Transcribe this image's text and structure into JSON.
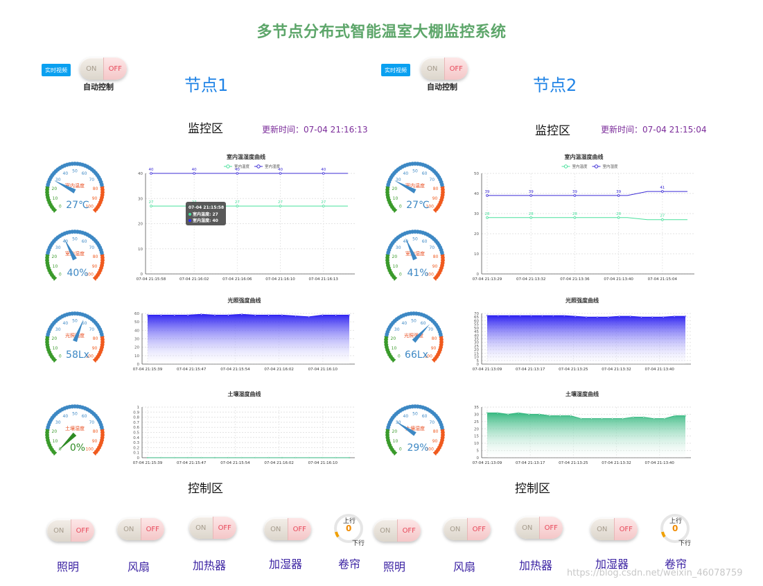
{
  "header": {
    "title": "多节点分布式智能温室大棚监控系统"
  },
  "nodes": [
    {
      "video_label": "实时视频",
      "auto_control_label": "自动控制",
      "auto_toggle": {
        "on": "ON",
        "off": "OFF"
      },
      "name": "节点1",
      "monitor_title": "监控区",
      "update_time": "更新时间：07-04 21:16:13",
      "gauges": [
        {
          "title": "室内温度",
          "value": 27,
          "display": "27℃",
          "color": "#3d88c4"
        },
        {
          "title": "室内湿度",
          "value": 40,
          "display": "40%",
          "color": "#3d88c4"
        },
        {
          "title": "光照强度",
          "value": 58,
          "display": "58Lx",
          "color": "#3d88c4"
        },
        {
          "title": "土壤湿度",
          "value": 0,
          "display": "0%",
          "color": "#2e8b24"
        }
      ],
      "temp_chart": {
        "title": "室内温湿度曲线",
        "legend": [
          "室内温度",
          "室内湿度"
        ],
        "ylim": [
          0,
          40
        ],
        "yticks": [
          "0",
          "10",
          "20",
          "30",
          "40"
        ],
        "xticks": [
          "07-04 21:15:58",
          "07-04 21:16:02",
          "07-04 21:16:06",
          "07-04 21:16:10",
          "07-04 21:16:13"
        ],
        "series": [
          {
            "name": "室内温度",
            "values": [
              27,
              27,
              27,
              27,
              27,
              27
            ],
            "labels": [
              "27",
              "27",
              "27",
              "27",
              "27"
            ]
          },
          {
            "name": "室内湿度",
            "values": [
              40,
              40,
              40,
              40,
              40,
              40
            ],
            "labels": [
              "40",
              "40",
              "40",
              "40",
              "40"
            ]
          }
        ],
        "tooltip": {
          "time": "07-04 21:15:58",
          "line1": "室内温度: 27",
          "line2": "室内湿度: 40"
        }
      },
      "light_chart": {
        "title": "光照强度曲线",
        "ylim": [
          0,
          60
        ],
        "yticks": [
          "0",
          "10",
          "20",
          "30",
          "40",
          "50",
          "60"
        ],
        "xticks": [
          "07-04 21:15:39",
          "07-04 21:15:47",
          "07-04 21:15:54",
          "07-04 21:16:02",
          "07-04 21:16:10"
        ],
        "values": [
          58,
          58,
          58,
          58,
          59,
          58,
          58,
          59,
          58,
          58,
          58,
          57,
          56,
          58,
          58,
          58
        ]
      },
      "soil_chart": {
        "title": "土壤湿度曲线",
        "ylim": [
          0,
          1
        ],
        "yticks": [
          "0",
          "0.1",
          "0.2",
          "0.3",
          "0.4",
          "0.5",
          "0.6",
          "0.7",
          "0.8",
          "0.9",
          "1"
        ],
        "xticks": [
          "07-04 21:15:39",
          "07-04 21:15:47",
          "07-04 21:15:54",
          "07-04 21:16:02",
          "07-04 21:16:10"
        ],
        "values": [
          0,
          0,
          0,
          0,
          0,
          0,
          0,
          0,
          0,
          0,
          0,
          0,
          0,
          0,
          0,
          0
        ]
      },
      "control_title": "控制区",
      "controls": [
        {
          "label": "照明",
          "on": "ON",
          "off": "OFF"
        },
        {
          "label": "风扇",
          "on": "ON",
          "off": "OFF"
        },
        {
          "label": "加热器",
          "on": "ON",
          "off": "OFF"
        },
        {
          "label": "加湿器",
          "on": "ON",
          "off": "OFF"
        }
      ],
      "curtain": {
        "label": "卷帘",
        "up": "上行",
        "down": "下行",
        "value": "0"
      }
    },
    {
      "video_label": "实时视频",
      "auto_control_label": "自动控制",
      "auto_toggle": {
        "on": "ON",
        "off": "OFF"
      },
      "name": "节点2",
      "monitor_title": "监控区",
      "update_time": "更新时间：07-04 21:15:04",
      "gauges": [
        {
          "title": "室内温度",
          "value": 27,
          "display": "27℃",
          "color": "#3d88c4"
        },
        {
          "title": "室内湿度",
          "value": 41,
          "display": "41%",
          "color": "#3d88c4"
        },
        {
          "title": "光照强度",
          "value": 66,
          "display": "66Lx",
          "color": "#3d88c4"
        },
        {
          "title": "土壤湿度",
          "value": 29,
          "display": "29%",
          "color": "#3d88c4"
        }
      ],
      "temp_chart": {
        "title": "室内温湿度曲线",
        "legend": [
          "室内温度",
          "室内湿度"
        ],
        "ylim": [
          0,
          50
        ],
        "yticks": [
          "0",
          "10",
          "20",
          "30",
          "40",
          "50"
        ],
        "xticks": [
          "07-04 21:13:29",
          "07-04 21:13:32",
          "07-04 21:13:36",
          "07-04 21:13:40",
          "07-04 21:15:04"
        ],
        "series": [
          {
            "name": "室内温度",
            "values": [
              28,
              28,
              28,
              28,
              28,
              28,
              28,
              28,
              27,
              27,
              27
            ],
            "labels": [
              "28",
              "28",
              "28",
              "28",
              "27"
            ]
          },
          {
            "name": "室内湿度",
            "values": [
              39,
              39,
              39,
              39,
              39,
              39,
              39,
              39,
              41,
              41,
              41
            ],
            "labels": [
              "39",
              "39",
              "39",
              "39",
              "41"
            ]
          }
        ]
      },
      "light_chart": {
        "title": "光照强度曲线",
        "ylim": [
          0,
          70
        ],
        "yticks": [
          "0",
          "5",
          "10",
          "15",
          "20",
          "25",
          "30",
          "35",
          "40",
          "45",
          "50",
          "55",
          "60",
          "65",
          "70"
        ],
        "xticks": [
          "07-04 21:13:09",
          "07-04 21:13:17",
          "07-04 21:13:25",
          "07-04 21:13:32",
          "07-04 21:13:40"
        ],
        "values": [
          67,
          67,
          67,
          67,
          67,
          67,
          67,
          67,
          66,
          65,
          65,
          65,
          66,
          66,
          65,
          65,
          65,
          66,
          66
        ]
      },
      "soil_chart": {
        "title": "土壤湿度曲线",
        "ylim": [
          0,
          35
        ],
        "yticks": [
          "0",
          "5",
          "10",
          "15",
          "20",
          "25",
          "30",
          "35"
        ],
        "xticks": [
          "07-04 21:13:09",
          "07-04 21:13:17",
          "07-04 21:13:25",
          "07-04 21:13:32",
          "07-04 21:13:40"
        ],
        "values": [
          31,
          31,
          30,
          31,
          30,
          30,
          29,
          29,
          29,
          27,
          27,
          27,
          27,
          27,
          28,
          28,
          27,
          27,
          29,
          29
        ]
      },
      "control_title": "控制区",
      "controls": [
        {
          "label": "照明",
          "on": "ON",
          "off": "OFF"
        },
        {
          "label": "风扇",
          "on": "ON",
          "off": "OFF"
        },
        {
          "label": "加热器",
          "on": "ON",
          "off": "OFF"
        },
        {
          "label": "加湿器",
          "on": "ON",
          "off": "OFF"
        }
      ],
      "curtain": {
        "label": "卷帘",
        "up": "上行",
        "down": "下行",
        "value": "0"
      }
    }
  ],
  "colors": {
    "temp_line": "#48e09c",
    "humid_line": "#3b2bd6",
    "light": "#2418f0",
    "soil": "#2fb67c",
    "gauge_red": "#f05a1e",
    "gauge_green": "#3a9a2b",
    "gauge_blue": "#3d88c4"
  },
  "watermark": "https://blog.csdn.net/weixin_46078759"
}
